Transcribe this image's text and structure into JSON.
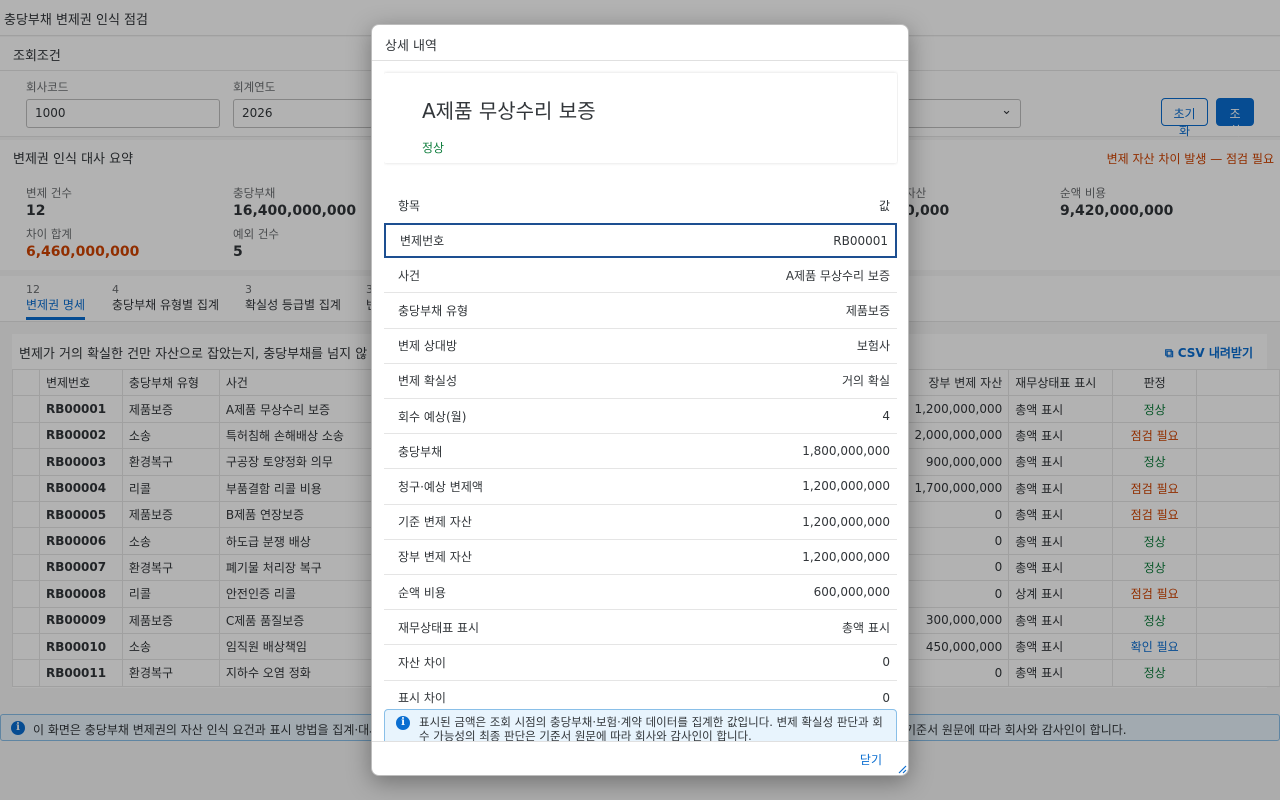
{
  "app": {
    "title": "충당부채 변제권 인식 점검"
  },
  "filter": {
    "title": "조회조건",
    "company_label": "회사코드",
    "company_value": "1000",
    "year_label": "회계연도",
    "year_value": "2026",
    "reset_label": "초기화",
    "search_label": "조회"
  },
  "summary": {
    "title": "변제권 인식 대사 요약",
    "alert": "변제 자산 차이 발생 — 점검 필요",
    "kpis": [
      {
        "label": "변제 건수",
        "value": "12"
      },
      {
        "label": "충당부채",
        "value": "16,400,000,000"
      },
      {
        "label": "자산",
        "value": "0,000"
      },
      {
        "label": "순액 비용",
        "value": "9,420,000,000"
      },
      {
        "label": "차이 합계",
        "value": "6,460,000,000"
      },
      {
        "label": "예외 건수",
        "value": "5"
      }
    ]
  },
  "tabs": [
    {
      "count": "12",
      "label": "변제권 명세"
    },
    {
      "count": "4",
      "label": "충당부채 유형별 집계"
    },
    {
      "count": "3",
      "label": "확실성 등급별 집계"
    },
    {
      "count": "3",
      "label": "변"
    }
  ],
  "table": {
    "caption": "변제가 거의 확실한 건만 자산으로 잡았는지, 충당부채를 넘지 않",
    "csv_label": "CSV 내려받기",
    "headers": [
      "변제번호",
      "충당부채 유형",
      "사건",
      "장부 변제 자산",
      "재무상태표 표시",
      "판정"
    ],
    "rows": [
      {
        "no": "RB00001",
        "type": "제품보증",
        "event": "A제품 무상수리 보증",
        "asset": "1,200,000,000",
        "disp": "총액 표시",
        "result": "정상",
        "cls": "ok"
      },
      {
        "no": "RB00002",
        "type": "소송",
        "event": "특허침해 손해배상 소송",
        "asset": "2,000,000,000",
        "disp": "총액 표시",
        "result": "점검 필요",
        "cls": "warn"
      },
      {
        "no": "RB00003",
        "type": "환경복구",
        "event": "구공장 토양정화 의무",
        "asset": "900,000,000",
        "disp": "총액 표시",
        "result": "정상",
        "cls": "ok"
      },
      {
        "no": "RB00004",
        "type": "리콜",
        "event": "부품결함 리콜 비용",
        "asset": "1,700,000,000",
        "disp": "총액 표시",
        "result": "점검 필요",
        "cls": "warn"
      },
      {
        "no": "RB00005",
        "type": "제품보증",
        "event": "B제품 연장보증",
        "asset": "0",
        "disp": "총액 표시",
        "result": "점검 필요",
        "cls": "warn"
      },
      {
        "no": "RB00006",
        "type": "소송",
        "event": "하도급 분쟁 배상",
        "asset": "0",
        "disp": "총액 표시",
        "result": "정상",
        "cls": "ok"
      },
      {
        "no": "RB00007",
        "type": "환경복구",
        "event": "폐기물 처리장 복구",
        "asset": "0",
        "disp": "총액 표시",
        "result": "정상",
        "cls": "ok"
      },
      {
        "no": "RB00008",
        "type": "리콜",
        "event": "안전인증 리콜",
        "asset": "0",
        "disp": "상계 표시",
        "result": "점검 필요",
        "cls": "warn"
      },
      {
        "no": "RB00009",
        "type": "제품보증",
        "event": "C제품 품질보증",
        "asset": "300,000,000",
        "disp": "총액 표시",
        "result": "정상",
        "cls": "ok"
      },
      {
        "no": "RB00010",
        "type": "소송",
        "event": "임직원 배상책임",
        "asset": "450,000,000",
        "disp": "총액 표시",
        "result": "확인 필요",
        "cls": "info"
      },
      {
        "no": "RB00011",
        "type": "환경복구",
        "event": "지하수 오염 정화",
        "asset": "0",
        "disp": "총액 표시",
        "result": "정상",
        "cls": "ok"
      }
    ]
  },
  "footer_info": {
    "left": "이 화면은 충당부채 변제권의 자산 인식 요건과 표시 방법을 집계·대사",
    "right": "기준서 원문에 따라 회사와 감사인이 합니다."
  },
  "dialog": {
    "title": "상세 내역",
    "item_title": "A제품 무상수리 보증",
    "item_status": "정상",
    "col_item": "항목",
    "col_value": "값",
    "rows": [
      {
        "k": "변제번호",
        "v": "RB00001"
      },
      {
        "k": "사건",
        "v": "A제품 무상수리 보증"
      },
      {
        "k": "충당부채 유형",
        "v": "제품보증"
      },
      {
        "k": "변제 상대방",
        "v": "보험사"
      },
      {
        "k": "변제 확실성",
        "v": "거의 확실"
      },
      {
        "k": "회수 예상(월)",
        "v": "4"
      },
      {
        "k": "충당부채",
        "v": "1,800,000,000"
      },
      {
        "k": "청구·예상 변제액",
        "v": "1,200,000,000"
      },
      {
        "k": "기준 변제 자산",
        "v": "1,200,000,000"
      },
      {
        "k": "장부 변제 자산",
        "v": "1,200,000,000"
      },
      {
        "k": "순액 비용",
        "v": "600,000,000"
      },
      {
        "k": "재무상태표 표시",
        "v": "총액 표시"
      },
      {
        "k": "자산 차이",
        "v": "0"
      },
      {
        "k": "표시 차이",
        "v": "0"
      }
    ],
    "info": "표시된 금액은 조회 시점의 충당부채·보험·계약 데이터를 집계한 값입니다. 변제 확실성 판단과 회수 가능성의 최종 판단은 기준서 원문에 따라 회사와 감사인이 합니다.",
    "close_label": "닫기"
  },
  "colors": {
    "accent": "#0a6ed1",
    "ok": "#107e3e",
    "warn": "#d04300",
    "overlay": "rgba(0,0,0,0.30)"
  }
}
